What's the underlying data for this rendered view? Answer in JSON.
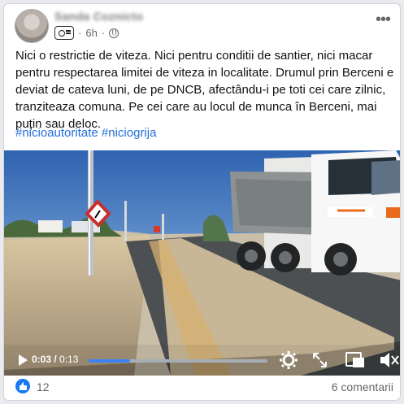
{
  "post": {
    "author": "Sanda Coznicto",
    "time": "6h",
    "text": "Nici o restrictie de viteza. Nici pentru conditii de santier, nici macar pentru respectarea limitei de viteza in localitate. Drumul prin Berceni e deviat de cateva luni, de pe DNCB, afectându-i pe toti cei care zilnic, tranziteaza comuna. Pe cei care au locul de munca în Berceni, mai puțin sau deloc.",
    "hashtags": [
      "#nicioautoritate",
      "#niciogrija"
    ]
  },
  "video": {
    "current_time": "0:03",
    "duration": "0:13",
    "progress": 0.23
  },
  "footer": {
    "likes": "12",
    "comments": "6 comentarii"
  },
  "colors": {
    "accent": "#1877f2",
    "hashtag": "#216fdb"
  }
}
